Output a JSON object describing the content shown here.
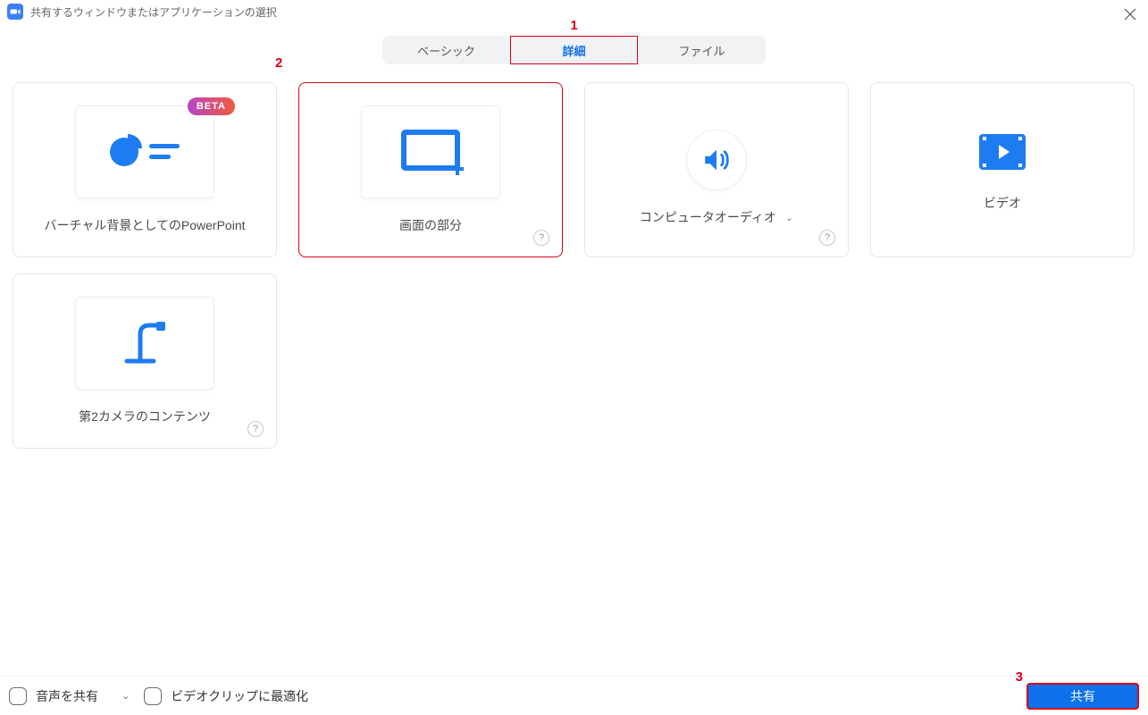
{
  "title": "共有するウィンドウまたはアプリケーションの選択",
  "tabs": {
    "basic": "ベーシック",
    "advanced": "詳細",
    "files": "ファイル"
  },
  "annotations": {
    "n1": "1",
    "n2": "2",
    "n3": "3"
  },
  "cards": {
    "ppt_bg": {
      "label": "バーチャル背景としてのPowerPoint",
      "badge": "BETA"
    },
    "portion": {
      "label": "画面の部分"
    },
    "audio": {
      "label": "コンピュータオーディオ"
    },
    "video": {
      "label": "ビデオ"
    },
    "second_cam": {
      "label": "第2カメラのコンテンツ"
    }
  },
  "footer": {
    "share_audio": "音声を共有",
    "optimize_video": "ビデオクリップに最適化",
    "share_button": "共有"
  }
}
